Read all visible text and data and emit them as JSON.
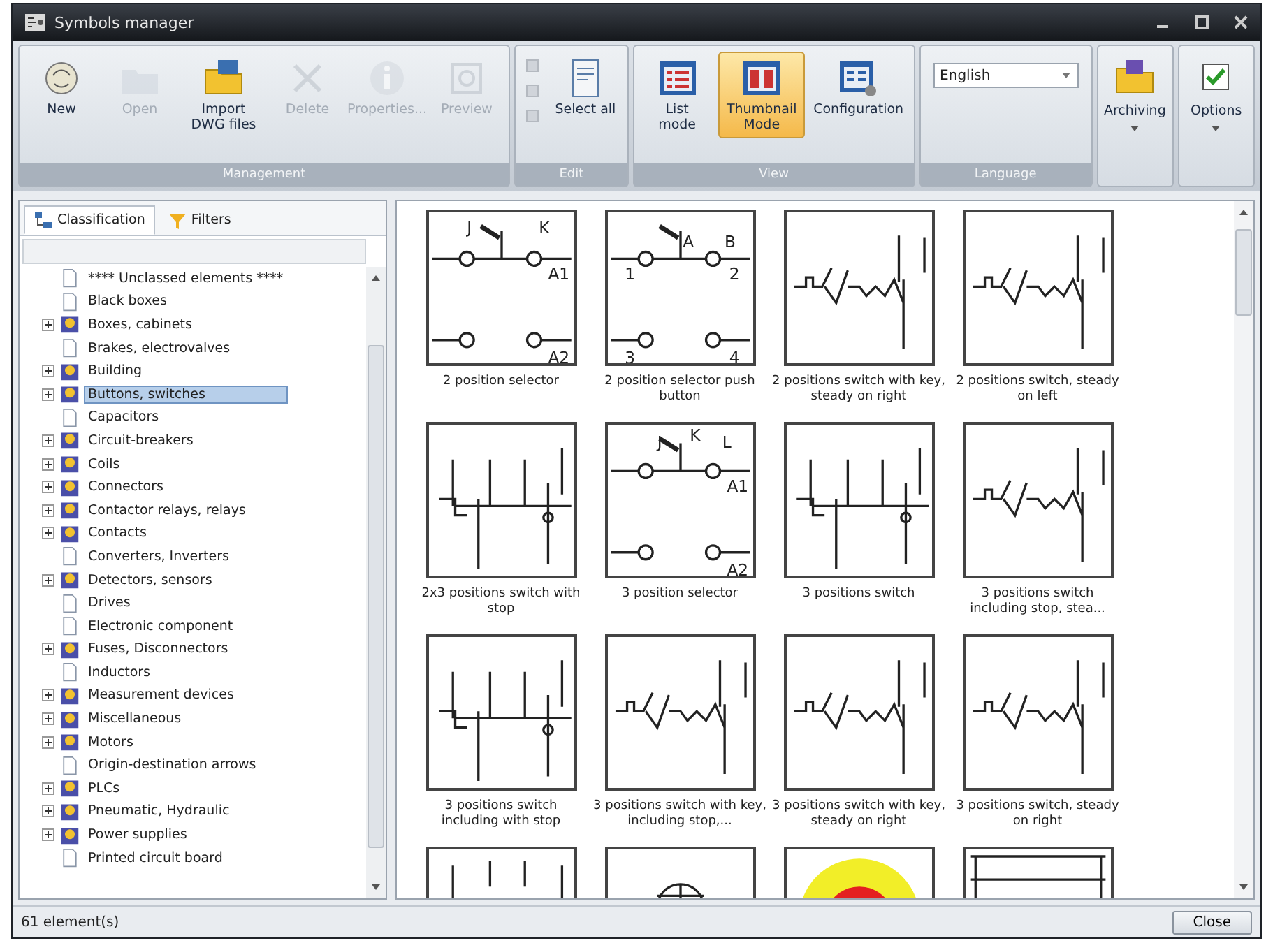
{
  "window": {
    "title": "Symbols manager"
  },
  "ribbon": {
    "groups": [
      {
        "label": "Management",
        "buttons": [
          {
            "label": "New",
            "disabled": false,
            "selected": false
          },
          {
            "label": "Open",
            "disabled": true,
            "selected": false
          },
          {
            "label": "Import DWG files",
            "disabled": false,
            "selected": false
          },
          {
            "label": "Delete",
            "disabled": true,
            "selected": false
          },
          {
            "label": "Properties...",
            "disabled": true,
            "selected": false
          },
          {
            "label": "Preview",
            "disabled": true,
            "selected": false
          }
        ]
      },
      {
        "label": "Edit",
        "buttons": [
          {
            "label": "Select all",
            "disabled": false,
            "selected": false
          }
        ]
      },
      {
        "label": "View",
        "buttons": [
          {
            "label": "List mode",
            "disabled": false,
            "selected": false
          },
          {
            "label": "Thumbnail Mode",
            "disabled": false,
            "selected": true
          },
          {
            "label": "Configuration",
            "disabled": false,
            "selected": false
          }
        ]
      },
      {
        "label": "Language",
        "dropdown": {
          "value": "English"
        }
      }
    ],
    "extra_buttons": [
      {
        "label": "Archiving"
      },
      {
        "label": "Options"
      }
    ]
  },
  "left_panel": {
    "tabs": [
      {
        "label": "Classification",
        "selected": true
      },
      {
        "label": "Filters",
        "selected": false
      }
    ],
    "tree": [
      {
        "label": "**** Unclassed elements ****",
        "kind": "document",
        "expandable": false,
        "selected": false
      },
      {
        "label": "Black boxes",
        "kind": "document",
        "expandable": false,
        "selected": false
      },
      {
        "label": "Boxes, cabinets",
        "kind": "folder",
        "expandable": true,
        "selected": false
      },
      {
        "label": "Brakes, electrovalves",
        "kind": "document",
        "expandable": false,
        "selected": false
      },
      {
        "label": "Building",
        "kind": "folder",
        "expandable": true,
        "selected": false
      },
      {
        "label": "Buttons, switches",
        "kind": "folder",
        "expandable": true,
        "selected": true
      },
      {
        "label": "Capacitors",
        "kind": "document",
        "expandable": false,
        "selected": false
      },
      {
        "label": "Circuit-breakers",
        "kind": "folder",
        "expandable": true,
        "selected": false
      },
      {
        "label": "Coils",
        "kind": "folder",
        "expandable": true,
        "selected": false
      },
      {
        "label": "Connectors",
        "kind": "folder",
        "expandable": true,
        "selected": false
      },
      {
        "label": "Contactor relays, relays",
        "kind": "folder",
        "expandable": true,
        "selected": false
      },
      {
        "label": "Contacts",
        "kind": "folder",
        "expandable": true,
        "selected": false
      },
      {
        "label": "Converters, Inverters",
        "kind": "document",
        "expandable": false,
        "selected": false
      },
      {
        "label": "Detectors, sensors",
        "kind": "folder",
        "expandable": true,
        "selected": false
      },
      {
        "label": "Drives",
        "kind": "document",
        "expandable": false,
        "selected": false
      },
      {
        "label": "Electronic component",
        "kind": "document",
        "expandable": false,
        "selected": false
      },
      {
        "label": "Fuses, Disconnectors",
        "kind": "folder",
        "expandable": true,
        "selected": false
      },
      {
        "label": "Inductors",
        "kind": "document",
        "expandable": false,
        "selected": false
      },
      {
        "label": "Measurement devices",
        "kind": "folder",
        "expandable": true,
        "selected": false
      },
      {
        "label": "Miscellaneous",
        "kind": "folder",
        "expandable": true,
        "selected": false
      },
      {
        "label": "Motors",
        "kind": "folder",
        "expandable": true,
        "selected": false
      },
      {
        "label": "Origin-destination arrows",
        "kind": "document",
        "expandable": false,
        "selected": false
      },
      {
        "label": "PLCs",
        "kind": "folder",
        "expandable": true,
        "selected": false
      },
      {
        "label": "Pneumatic, Hydraulic",
        "kind": "folder",
        "expandable": true,
        "selected": false
      },
      {
        "label": "Power supplies",
        "kind": "folder",
        "expandable": true,
        "selected": false
      },
      {
        "label": "Printed circuit board",
        "kind": "document",
        "expandable": false,
        "selected": false
      }
    ]
  },
  "thumbnails": [
    {
      "caption": "2 position selector",
      "kind": "selector",
      "labels": [
        "J",
        "K",
        "A1",
        "A2"
      ]
    },
    {
      "caption": "2 position selector push button",
      "kind": "selector",
      "labels": [
        "A",
        "B",
        "1",
        "2",
        "3",
        "4"
      ]
    },
    {
      "caption": "2 positions switch with key, steady on right",
      "kind": "switch"
    },
    {
      "caption": "2 positions switch, steady on left",
      "kind": "switch"
    },
    {
      "caption": "2x3 positions switch with stop",
      "kind": "multi-switch"
    },
    {
      "caption": "3 position selector",
      "kind": "selector",
      "labels": [
        "J",
        "K",
        "L",
        "A1",
        "A2"
      ]
    },
    {
      "caption": "3 positions switch",
      "kind": "multi-switch"
    },
    {
      "caption": "3 positions switch including stop, stea...",
      "kind": "switch"
    },
    {
      "caption": "3 positions switch including with stop",
      "kind": "multi-switch"
    },
    {
      "caption": "3 positions switch with key, including stop,...",
      "kind": "switch"
    },
    {
      "caption": "3 positions switch with key, steady on right",
      "kind": "switch"
    },
    {
      "caption": "3 positions switch, steady on right",
      "kind": "switch"
    },
    {
      "kind": "contact-strip"
    },
    {
      "kind": "dial"
    },
    {
      "kind": "emergency-stop"
    },
    {
      "kind": "terminal-strip"
    }
  ],
  "status_bar": {
    "count": "61 element(s)",
    "close_button": "Close"
  }
}
